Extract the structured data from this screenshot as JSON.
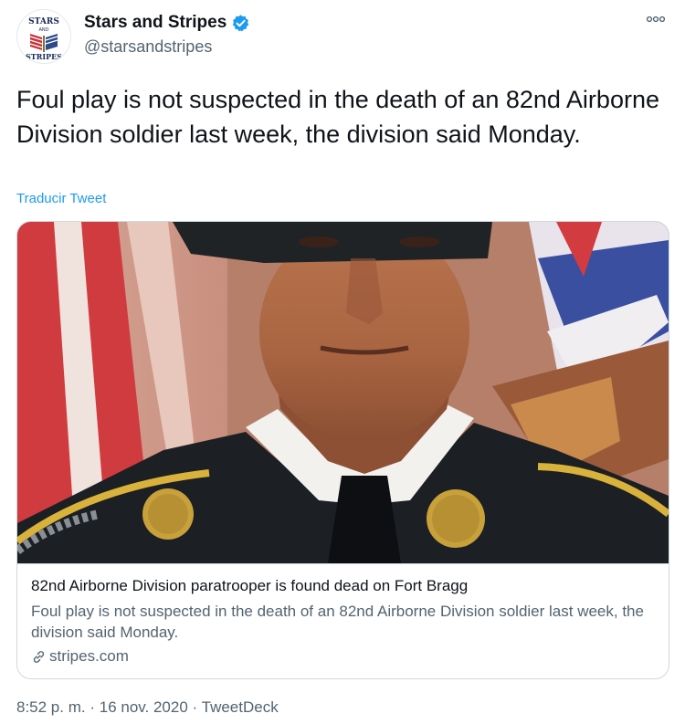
{
  "account": {
    "display_name": "Stars and Stripes",
    "handle": "@starsandstripes",
    "avatar_logo_top": "STARS",
    "avatar_logo_mid": "AND",
    "avatar_logo_bottom": "STRIPES"
  },
  "tweet": {
    "text": "Foul play is not suspected in the death of an 82nd Airborne Division soldier last week, the division said Monday.",
    "translate_label": "Traducir Tweet"
  },
  "card": {
    "title": "82nd Airborne Division paratrooper is found dead on Fort Bragg",
    "description": "Foul play is not suspected in the death of an 82nd Airborne Division soldier last week, the division said Monday.",
    "domain": "stripes.com"
  },
  "meta": {
    "time": "8:52 p. m.",
    "separator": "·",
    "date": "16 nov. 2020",
    "source": "TweetDeck"
  },
  "colors": {
    "link_blue": "#1d9bf0",
    "secondary_text": "#536471",
    "border": "#cfd9de"
  },
  "icons": {
    "verified": "verified-badge-icon",
    "more": "more-options-icon",
    "link": "link-icon"
  }
}
